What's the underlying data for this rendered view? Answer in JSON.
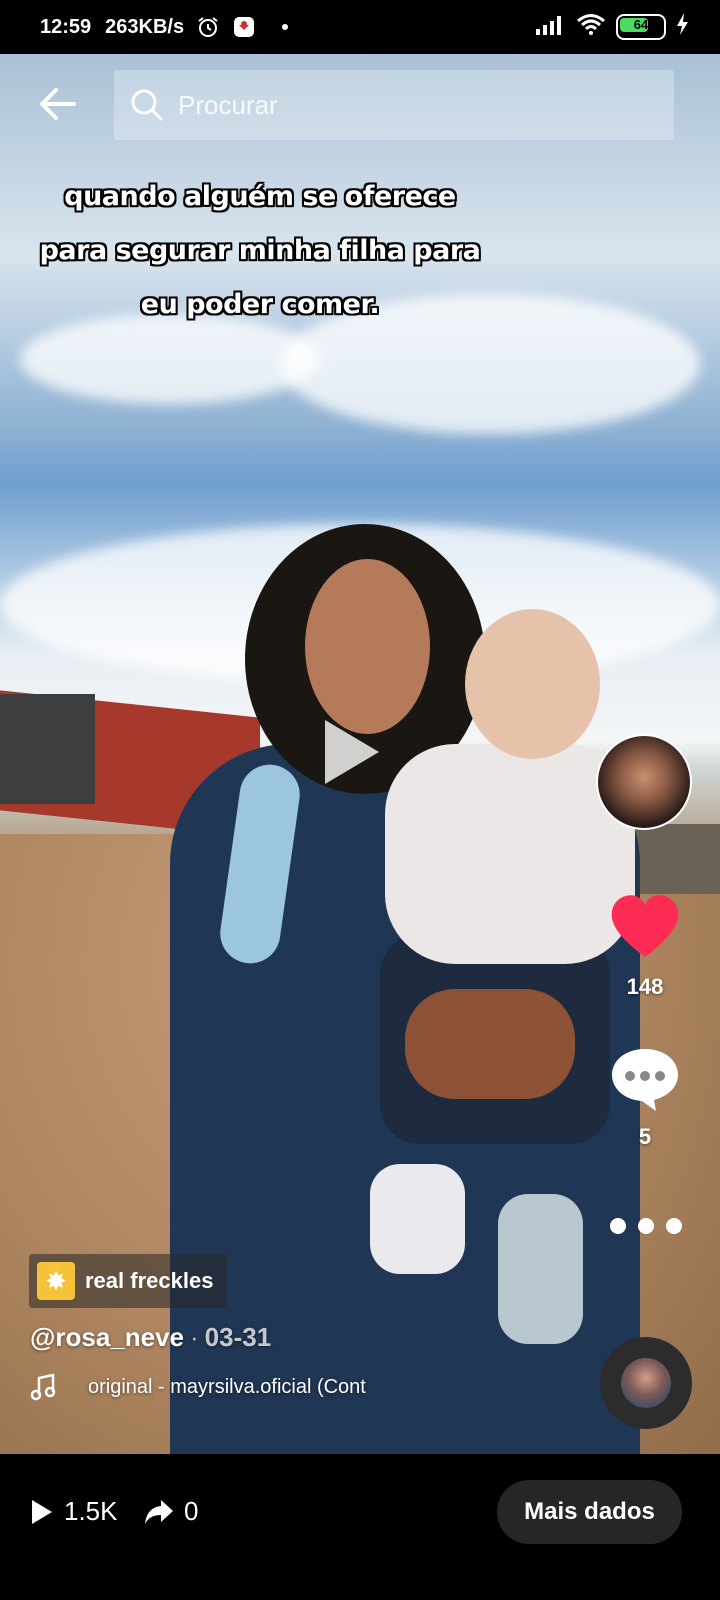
{
  "status_bar": {
    "time": "12:59",
    "speed": "263KB/s",
    "battery": "64"
  },
  "search": {
    "placeholder": "Procurar"
  },
  "caption": {
    "line1": "quando alguém se oferece",
    "line2": "para segurar minha filha para",
    "line3": "eu poder comer."
  },
  "rail": {
    "likes": "148",
    "comments": "5"
  },
  "effect": {
    "label": "real freckles"
  },
  "post": {
    "author": "@rosa_neve",
    "separator": "·",
    "date": "03-31",
    "music": "original - mayrsilva.oficial (Cont"
  },
  "bottom_bar": {
    "views": "1.5K",
    "shares": "0",
    "more_button": "Mais dados"
  },
  "colors": {
    "like_heart": "#fe2c55",
    "effect_icon": "#f6c23a"
  }
}
